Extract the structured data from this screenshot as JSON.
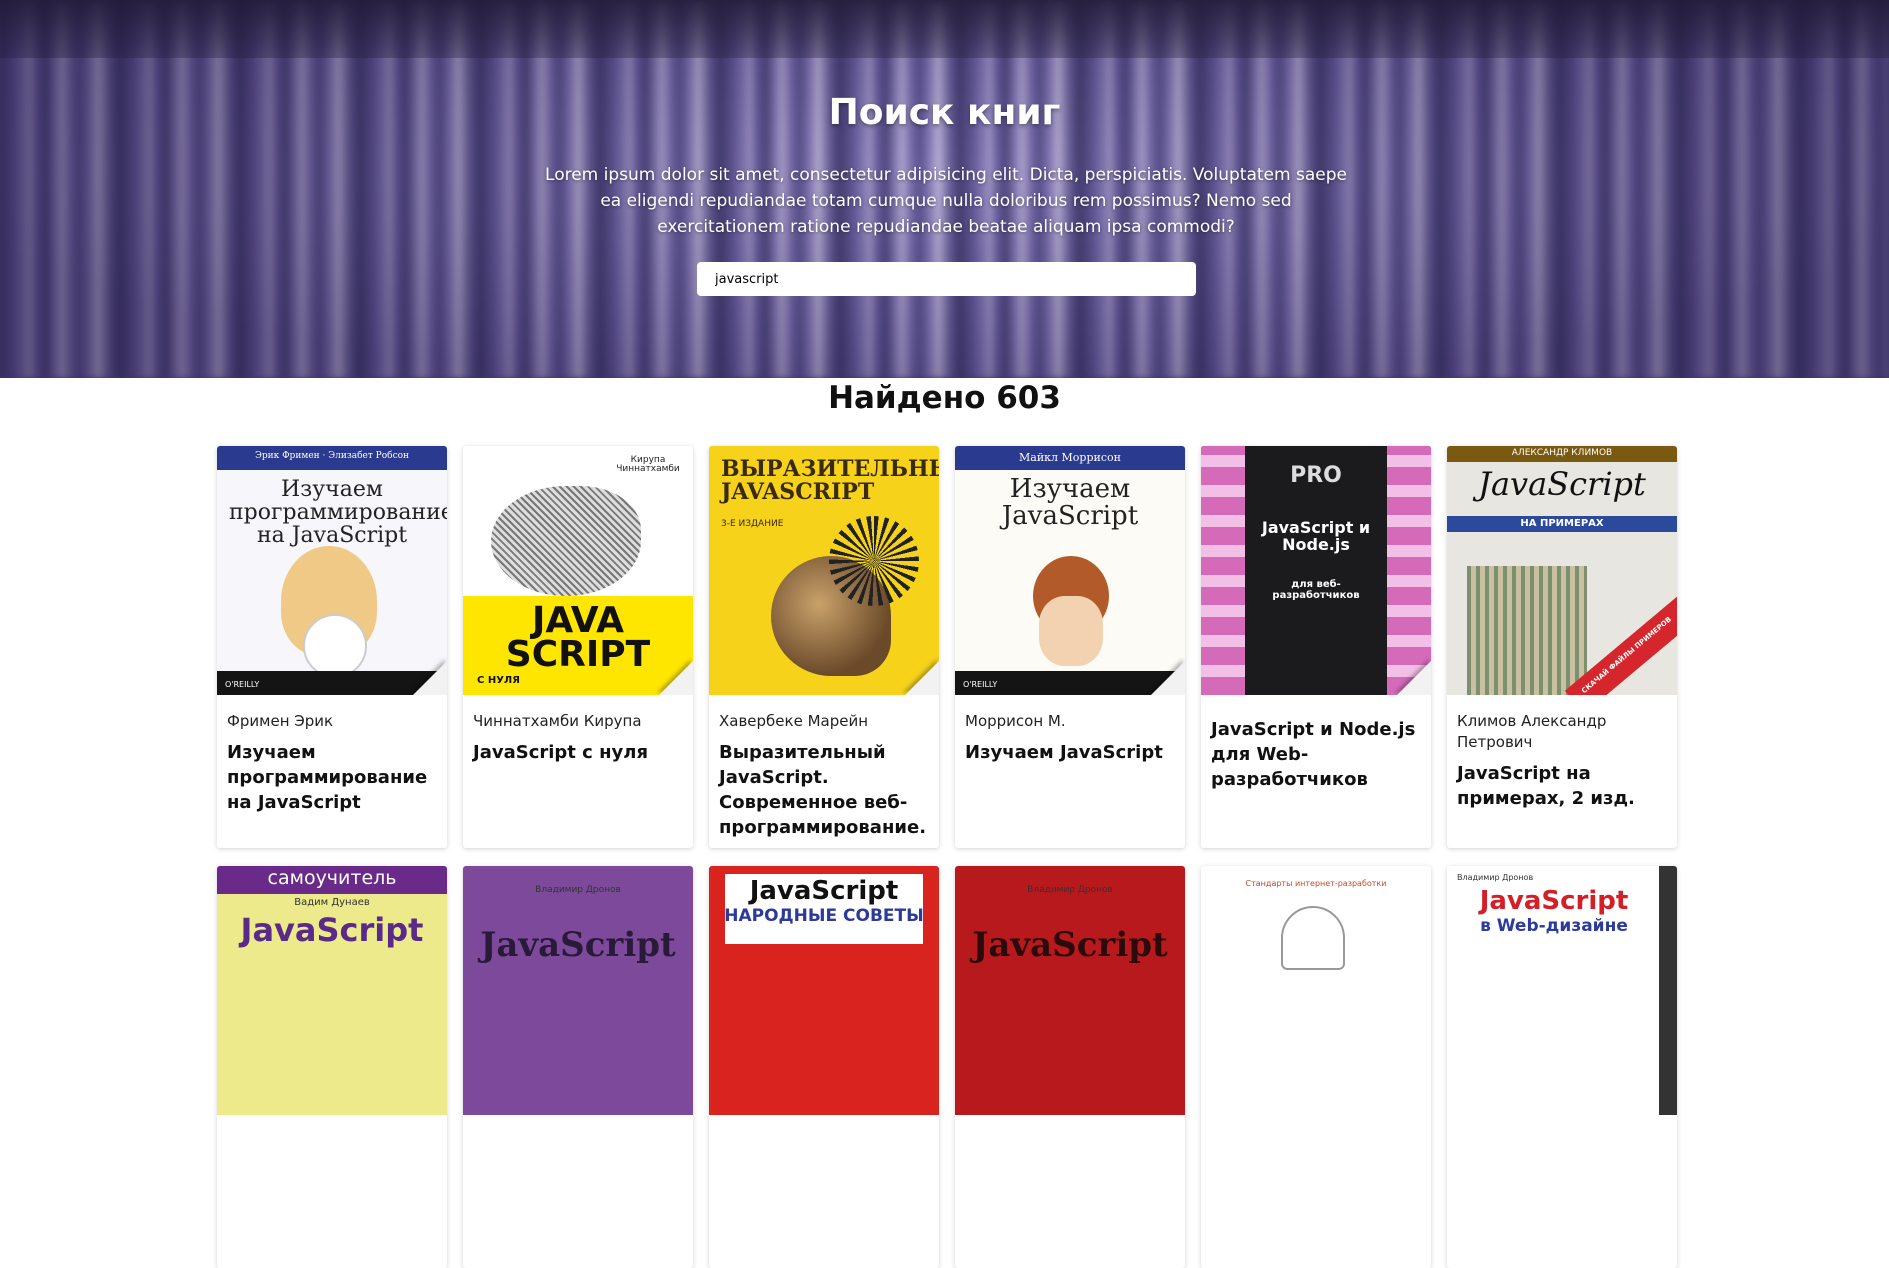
{
  "hero": {
    "title": "Поиск книг",
    "description": "Lorem ipsum dolor sit amet, consectetur adipisicing elit. Dicta, perspiciatis. Voluptatem saepe ea eligendi repudiandae totam cumque nulla doloribus rem possimus? Nemo sed exercitationem ratione repudiandae beatae aliquam ipsa commodi?"
  },
  "search": {
    "value": "javascript"
  },
  "results": {
    "title": "Найдено 603"
  },
  "books": [
    {
      "author": "Фримен Эрик",
      "title": "Изучаем программирование на JavaScript",
      "cover": {
        "top": "Эрик Фримен · Элизабет Робсон",
        "main": "Изучаем программирование на JavaScript",
        "publisher": "O'REILLY"
      }
    },
    {
      "author": "Чиннатхамби Кирупа",
      "title": "JavaScript с нуля",
      "cover": {
        "top": "Кирупа Чиннатхамби",
        "main": "JAVA SCRIPT",
        "sub": "С НУЛЯ"
      }
    },
    {
      "author": "Хавербеке Марейн",
      "title": "Выразительный JavaScript. Современное веб-программирование.",
      "cover": {
        "main": "ВЫРАЗИТЕЛЬНЫЙ JAVASCRIPT",
        "sub": "3-Е ИЗДАНИЕ"
      }
    },
    {
      "author": "Моррисон М.",
      "title": "Изучаем JavaScript",
      "cover": {
        "top": "Майкл Моррисон",
        "main": "Изучаем JavaScript",
        "publisher": "O'REILLY"
      }
    },
    {
      "author": "",
      "title": "JavaScript и Node.js для Web-разработчиков",
      "cover": {
        "top": "PRO",
        "main": "JavaScript и Node.js",
        "sub": "для веб-разработчиков"
      }
    },
    {
      "author": "Климов Александр Петрович",
      "title": "JavaScript на примерах, 2 изд.",
      "cover": {
        "top": "АЛЕКСАНДР КЛИМОВ",
        "main": "JavaScript",
        "sub": "НА ПРИМЕРАХ",
        "ribbon": "СКАЧАЙ ФАЙЛЫ ПРИМЕРОВ"
      }
    },
    {
      "author": "",
      "title": "",
      "cover": {
        "top": "самоучитель",
        "main": "JavaScript",
        "sub": "Вадим Дунаев"
      }
    },
    {
      "author": "",
      "title": "",
      "cover": {
        "top": "Владимир Дронов",
        "main": "JavaScript"
      }
    },
    {
      "author": "",
      "title": "",
      "cover": {
        "main": "JavaScript",
        "sub": "НАРОДНЫЕ СОВЕТЫ"
      }
    },
    {
      "author": "",
      "title": "",
      "cover": {
        "top": "Владимир Дронов",
        "main": "JavaScript"
      }
    },
    {
      "author": "",
      "title": "",
      "cover": {
        "top": "Стандарты интернет-разработки"
      }
    },
    {
      "author": "",
      "title": "",
      "cover": {
        "top": "Владимир Дронов",
        "main": "JavaScript",
        "sub": "в Web-дизайне"
      }
    }
  ]
}
